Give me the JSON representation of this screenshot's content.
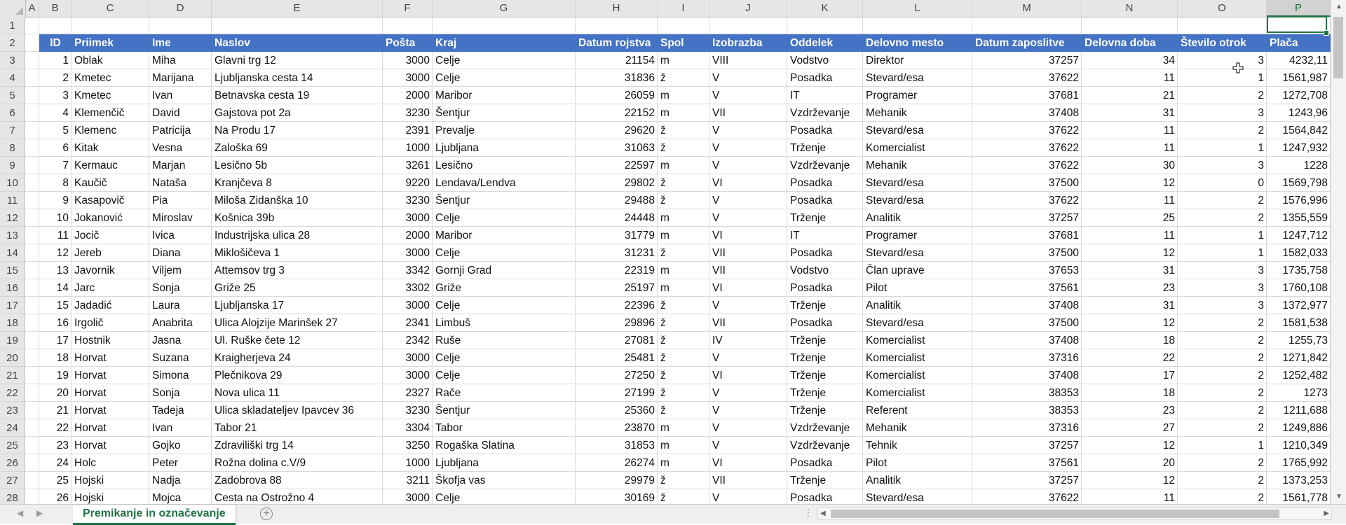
{
  "column_letters": [
    "A",
    "B",
    "C",
    "D",
    "E",
    "F",
    "G",
    "H",
    "I",
    "J",
    "K",
    "L",
    "M",
    "N",
    "O",
    "P"
  ],
  "selected_column": "P",
  "row_numbers": [
    "1",
    "2",
    "3",
    "4",
    "5",
    "6",
    "7",
    "8",
    "9",
    "10",
    "11",
    "12",
    "13",
    "14",
    "15",
    "16",
    "17",
    "18",
    "19",
    "20",
    "21",
    "22",
    "23",
    "24",
    "25",
    "26",
    "27",
    "28"
  ],
  "table": {
    "headers": [
      "ID",
      "Priimek",
      "Ime",
      "Naslov",
      "Pošta",
      "Kraj",
      "Datum rojstva",
      "Spol",
      "Izobrazba",
      "Oddelek",
      "Delovno mesto",
      "Datum zaposlitve",
      "Delovna doba",
      "Število otrok",
      "Plača"
    ],
    "rows": [
      [
        "1",
        "Oblak",
        "Miha",
        "Glavni trg 12",
        "3000",
        "Celje",
        "21154",
        "m",
        "VIII",
        "Vodstvo",
        "Direktor",
        "37257",
        "34",
        "3",
        "4232,11"
      ],
      [
        "2",
        "Kmetec",
        "Marijana",
        "Ljubljanska cesta 14",
        "3000",
        "Celje",
        "31836",
        "ž",
        "V",
        "Posadka",
        "Stevard/esa",
        "37622",
        "11",
        "1",
        "1561,987"
      ],
      [
        "3",
        "Kmetec",
        "Ivan",
        "Betnavska cesta 19",
        "2000",
        "Maribor",
        "26059",
        "m",
        "V",
        "IT",
        "Programer",
        "37681",
        "21",
        "2",
        "1272,708"
      ],
      [
        "4",
        "Klemenčič",
        "David",
        "Gajstova pot 2a",
        "3230",
        "Šentjur",
        "22152",
        "m",
        "VII",
        "Vzdrževanje",
        "Mehanik",
        "37408",
        "31",
        "3",
        "1243,96"
      ],
      [
        "5",
        "Klemenc",
        "Patricija",
        "Na Produ 17",
        "2391",
        "Prevalje",
        "29620",
        "ž",
        "V",
        "Posadka",
        "Stevard/esa",
        "37622",
        "11",
        "2",
        "1564,842"
      ],
      [
        "6",
        "Kitak",
        "Vesna",
        "Zaloška 69",
        "1000",
        "Ljubljana",
        "31063",
        "ž",
        "V",
        "Trženje",
        "Komercialist",
        "37622",
        "11",
        "1",
        "1247,932"
      ],
      [
        "7",
        "Kermauc",
        "Marjan",
        "Lesično 5b",
        "3261",
        "Lesično",
        "22597",
        "m",
        "V",
        "Vzdrževanje",
        "Mehanik",
        "37622",
        "30",
        "3",
        "1228"
      ],
      [
        "8",
        "Kaučič",
        "Nataša",
        "Kranjčeva 8",
        "9220",
        "Lendava/Lendva",
        "29802",
        "ž",
        "VI",
        "Posadka",
        "Stevard/esa",
        "37500",
        "12",
        "0",
        "1569,798"
      ],
      [
        "9",
        "Kasapovič",
        "Pia",
        "Miloša Zidanška 10",
        "3230",
        "Šentjur",
        "29488",
        "ž",
        "V",
        "Posadka",
        "Stevard/esa",
        "37622",
        "11",
        "2",
        "1576,996"
      ],
      [
        "10",
        "Jokanović",
        "Miroslav",
        "Košnica 39b",
        "3000",
        "Celje",
        "24448",
        "m",
        "V",
        "Trženje",
        "Analitik",
        "37257",
        "25",
        "2",
        "1355,559"
      ],
      [
        "11",
        "Jocič",
        "Ivica",
        "Industrijska ulica 28",
        "2000",
        "Maribor",
        "31779",
        "m",
        "VI",
        "IT",
        "Programer",
        "37681",
        "11",
        "1",
        "1247,712"
      ],
      [
        "12",
        "Jereb",
        "Diana",
        "Miklošičeva 1",
        "3000",
        "Celje",
        "31231",
        "ž",
        "VII",
        "Posadka",
        "Stevard/esa",
        "37500",
        "12",
        "1",
        "1582,033"
      ],
      [
        "13",
        "Javornik",
        "Viljem",
        "Attemsov trg 3",
        "3342",
        "Gornji Grad",
        "22319",
        "m",
        "VII",
        "Vodstvo",
        "Član uprave",
        "37653",
        "31",
        "3",
        "1735,758"
      ],
      [
        "14",
        "Jarc",
        "Sonja",
        "Griže 25",
        "3302",
        "Griže",
        "25197",
        "m",
        "VI",
        "Posadka",
        "Pilot",
        "37561",
        "23",
        "3",
        "1760,108"
      ],
      [
        "15",
        "Jadadić",
        "Laura",
        "Ljubljanska 17",
        "3000",
        "Celje",
        "22396",
        "ž",
        "V",
        "Trženje",
        "Analitik",
        "37408",
        "31",
        "3",
        "1372,977"
      ],
      [
        "16",
        "Irgolič",
        "Anabrita",
        "Ulica Alojzije Marinšek 27",
        "2341",
        "Limbuš",
        "29896",
        "ž",
        "VII",
        "Posadka",
        "Stevard/esa",
        "37500",
        "12",
        "2",
        "1581,538"
      ],
      [
        "17",
        "Hostnik",
        "Jasna",
        "Ul. Ruške čete 12",
        "2342",
        "Ruše",
        "27081",
        "ž",
        "IV",
        "Trženje",
        "Komercialist",
        "37408",
        "18",
        "2",
        "1255,73"
      ],
      [
        "18",
        "Horvat",
        "Suzana",
        "Kraigherjeva 24",
        "3000",
        "Celje",
        "25481",
        "ž",
        "V",
        "Trženje",
        "Komercialist",
        "37316",
        "22",
        "2",
        "1271,842"
      ],
      [
        "19",
        "Horvat",
        "Simona",
        "Plečnikova 29",
        "3000",
        "Celje",
        "27250",
        "ž",
        "VI",
        "Trženje",
        "Komercialist",
        "37408",
        "17",
        "2",
        "1252,482"
      ],
      [
        "20",
        "Horvat",
        "Sonja",
        "Nova ulica 11",
        "2327",
        "Rače",
        "27199",
        "ž",
        "V",
        "Trženje",
        "Komercialist",
        "38353",
        "18",
        "2",
        "1273"
      ],
      [
        "21",
        "Horvat",
        "Tadeja",
        "Ulica skladateljev Ipavcev 36",
        "3230",
        "Šentjur",
        "25360",
        "ž",
        "V",
        "Trženje",
        "Referent",
        "38353",
        "23",
        "2",
        "1211,688"
      ],
      [
        "22",
        "Horvat",
        "Ivan",
        "Tabor 21",
        "3304",
        "Tabor",
        "23870",
        "m",
        "V",
        "Vzdrževanje",
        "Mehanik",
        "37316",
        "27",
        "2",
        "1249,886"
      ],
      [
        "23",
        "Horvat",
        "Gojko",
        "Zdraviliški trg 14",
        "3250",
        "Rogaška Slatina",
        "31853",
        "m",
        "V",
        "Vzdrževanje",
        "Tehnik",
        "37257",
        "12",
        "1",
        "1210,349"
      ],
      [
        "24",
        "Holc",
        "Peter",
        "Rožna dolina c.V/9",
        "1000",
        "Ljubljana",
        "26274",
        "m",
        "VI",
        "Posadka",
        "Pilot",
        "37561",
        "20",
        "2",
        "1765,992"
      ],
      [
        "25",
        "Hojski",
        "Nadja",
        "Zadobrova 88",
        "3211",
        "Škofja vas",
        "29979",
        "ž",
        "VII",
        "Trženje",
        "Analitik",
        "37257",
        "12",
        "2",
        "1373,253"
      ],
      [
        "26",
        "Hojski",
        "Mojca",
        "Cesta na Ostrožno 4",
        "3000",
        "Celje",
        "30169",
        "ž",
        "V",
        "Posadka",
        "Stevard/esa",
        "37622",
        "11",
        "2",
        "1561,778"
      ]
    ]
  },
  "sheet_tab": {
    "label": "Premikanje in označevanje"
  },
  "icons": {
    "add_sheet": "plus-circle-icon",
    "cursor": "excel-cross-cursor-icon"
  },
  "colors": {
    "header_fill": "#4472c4",
    "accent": "#217346"
  }
}
